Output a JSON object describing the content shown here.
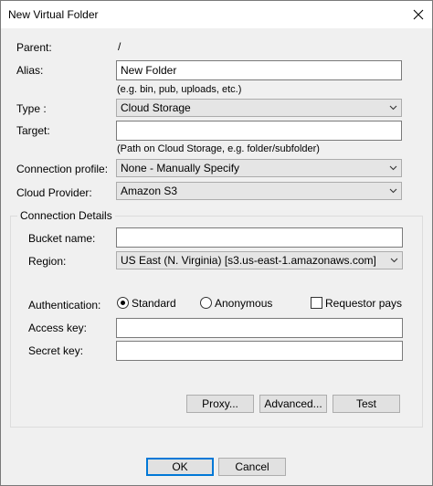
{
  "window": {
    "title": "New Virtual Folder"
  },
  "form": {
    "parent_label": "Parent:",
    "parent_value": "/",
    "alias_label": "Alias:",
    "alias_value": "New Folder",
    "alias_hint": "(e.g. bin, pub, uploads, etc.)",
    "type_label": "Type :",
    "type_value": "Cloud Storage",
    "target_label": "Target:",
    "target_value": "",
    "target_hint": "(Path on Cloud Storage, e.g. folder/subfolder)",
    "connection_profile_label": "Connection profile:",
    "connection_profile_value": "None - Manually Specify",
    "cloud_provider_label": "Cloud Provider:",
    "cloud_provider_value": "Amazon S3"
  },
  "connection_details": {
    "group_title": "Connection Details",
    "bucket_label": "Bucket name:",
    "bucket_value": "",
    "region_label": "Region:",
    "region_value": "US East (N. Virginia) [s3.us-east-1.amazonaws.com]",
    "auth_label": "Authentication:",
    "auth_standard": "Standard",
    "auth_anonymous": "Anonymous",
    "auth_selected": "Standard",
    "requestor_pays": "Requestor pays",
    "requestor_pays_checked": false,
    "access_key_label": "Access key:",
    "access_key_value": "",
    "secret_key_label": "Secret key:",
    "secret_key_value": "",
    "proxy_button": "Proxy...",
    "advanced_button": "Advanced...",
    "test_button": "Test"
  },
  "footer": {
    "ok_button": "OK",
    "cancel_button": "Cancel"
  },
  "icons": {
    "close": "close-icon",
    "dropdown": "chevron-down-icon"
  },
  "colors": {
    "focus_border": "#0078d7",
    "dialog_background": "#f0f0f0",
    "title_bar": "#ffffff"
  }
}
